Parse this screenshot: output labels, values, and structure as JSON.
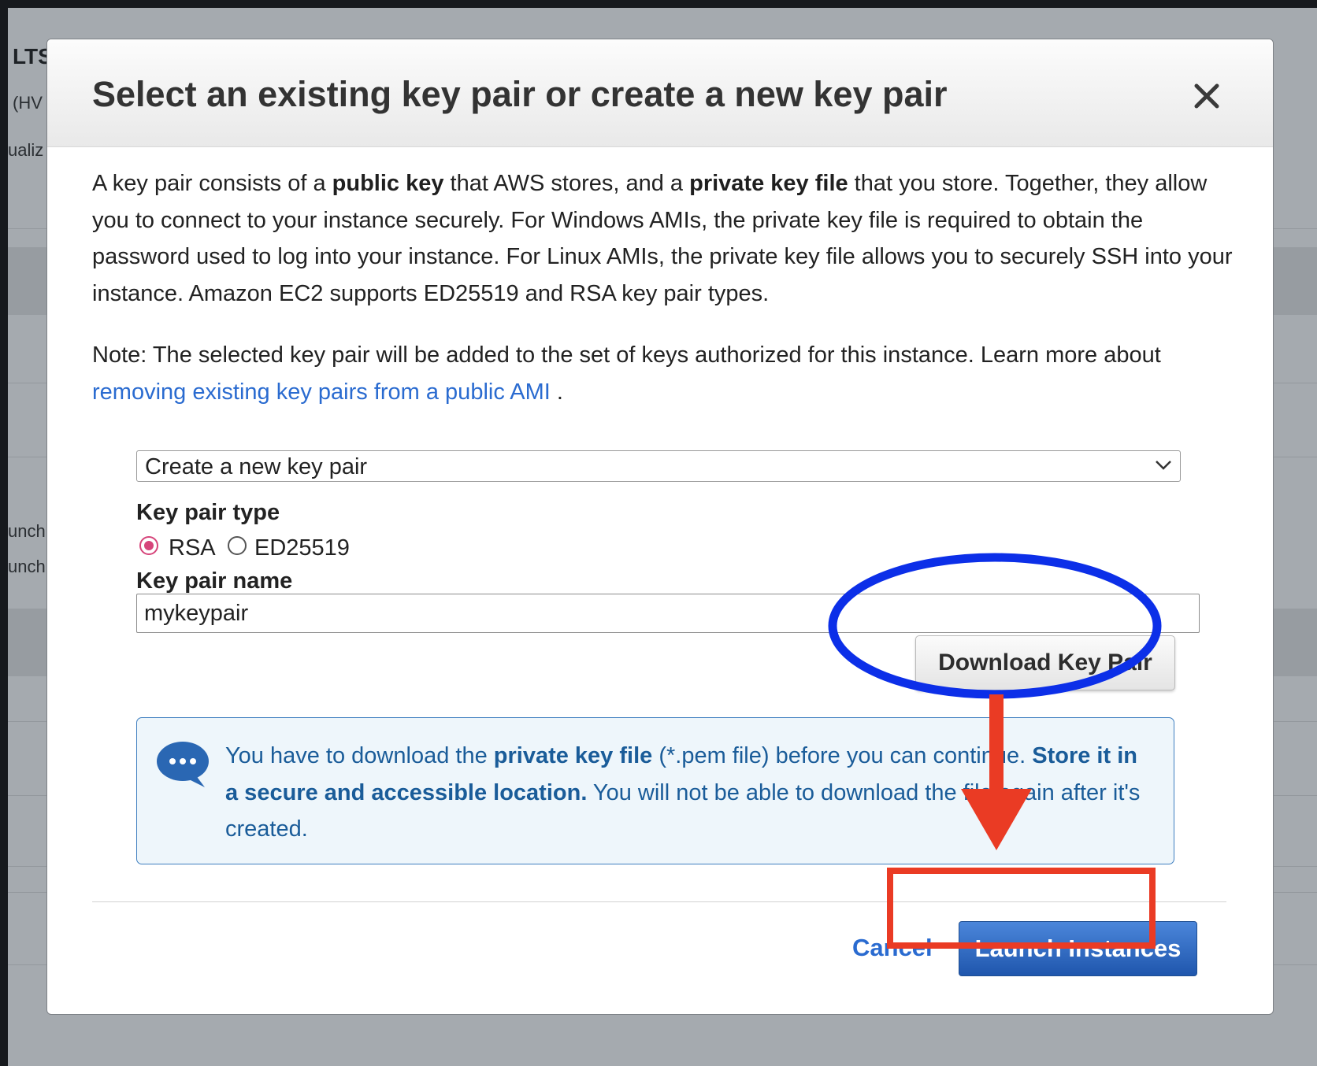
{
  "background": {
    "fragments": [
      "LTS",
      "(HV",
      "ualiz",
      "unch",
      "unch"
    ]
  },
  "modal": {
    "title": "Select an existing key pair or create a new key pair",
    "close_icon": "close-icon",
    "description": {
      "part1": "A key pair consists of a ",
      "bold1": "public key",
      "part2": " that AWS stores, and a ",
      "bold2": "private key file",
      "part3": " that you store. Together, they allow you to connect to your instance securely. For Windows AMIs, the private key file is required to obtain the password used to log into your instance. For Linux AMIs, the private key file allows you to securely SSH into your instance. Amazon EC2 supports ED25519 and RSA key pair types."
    },
    "note": {
      "text": "Note: The selected key pair will be added to the set of keys authorized for this instance. Learn more about ",
      "link": "removing existing key pairs from a public AMI",
      "suffix": " ."
    },
    "key_pair_select": {
      "selected": "Create a new key pair",
      "chevron_icon": "chevron-down-icon"
    },
    "key_pair_type": {
      "label": "Key pair type",
      "options": [
        {
          "label": "RSA",
          "checked": true
        },
        {
          "label": "ED25519",
          "checked": false
        }
      ]
    },
    "key_pair_name": {
      "label": "Key pair name",
      "value": "mykeypair"
    },
    "download_button": "Download Key Pair",
    "info": {
      "icon": "chat-bubble-icon",
      "part1": "You have to download the ",
      "bold1": "private key file",
      "part2": " (*.pem file) before you can continue. ",
      "bold2": "Store it in a secure and accessible location.",
      "part3": " You will not be able to download the file again after it's created."
    },
    "footer": {
      "cancel_label": "Cancel",
      "launch_label": "Launch Instances"
    }
  },
  "colors": {
    "primary_blue": "#1f56ad",
    "link_blue": "#2a6bd0",
    "annotation_ellipse": "#0c2fe8",
    "annotation_red": "#ea3b24",
    "radio_accent": "#d6447a"
  }
}
